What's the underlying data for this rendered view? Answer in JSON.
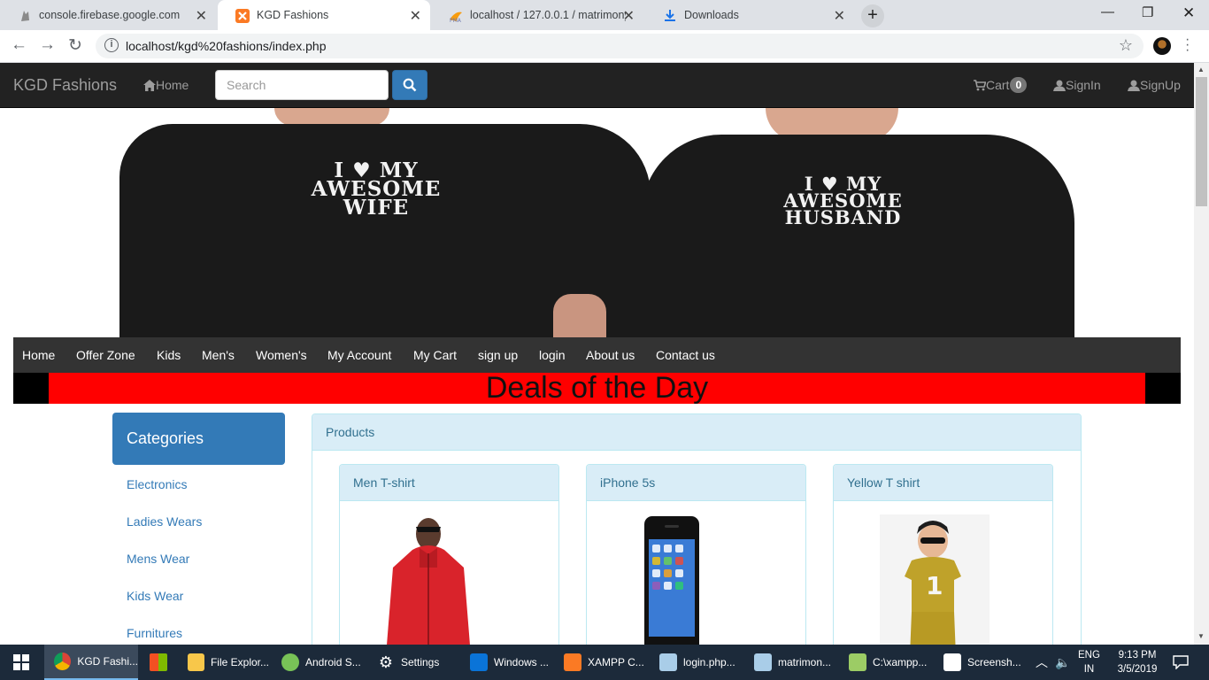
{
  "browser": {
    "tabs": [
      {
        "title": "console.firebase.google.com",
        "active": false
      },
      {
        "title": "KGD Fashions",
        "active": true
      },
      {
        "title": "localhost / 127.0.0.1 / matrimony",
        "active": false
      },
      {
        "title": "Downloads",
        "active": false
      }
    ],
    "url": "localhost/kgd%20fashions/index.php"
  },
  "site": {
    "brand": "KGD Fashions",
    "home": "Home",
    "search_placeholder": "Search",
    "cart": "Cart",
    "cart_count": "0",
    "signin": "SignIn",
    "signup": "SignUp"
  },
  "banner": {
    "left_shirt": [
      "I ♥ MY",
      "AWESOME",
      "WIFE"
    ],
    "right_shirt": [
      "I ♥ MY",
      "AWESOME",
      "HUSBAND"
    ]
  },
  "menu": [
    "Home",
    "Offer Zone",
    "Kids",
    "Men's",
    "Women's",
    "My Account",
    "My Cart",
    "sign up",
    "login",
    "About us",
    "Contact us"
  ],
  "deals": "Deals of the Day",
  "categories": {
    "title": "Categories",
    "items": [
      "Electronics",
      "Ladies Wears",
      "Mens Wear",
      "Kids Wear",
      "Furnitures"
    ]
  },
  "products": {
    "title": "Products",
    "items": [
      {
        "name": "Men T-shirt"
      },
      {
        "name": "iPhone 5s"
      },
      {
        "name": "Yellow T shirt"
      }
    ]
  },
  "taskbar": {
    "items": [
      "KGD Fashi...",
      "",
      "File Explor...",
      "Android S...",
      "Settings",
      "Windows ...",
      "XAMPP C...",
      "login.php...",
      "matrimon...",
      "C:\\xampp...",
      "Screensh..."
    ],
    "lang1": "ENG",
    "lang2": "IN",
    "time": "9:13 PM",
    "date": "3/5/2019"
  }
}
